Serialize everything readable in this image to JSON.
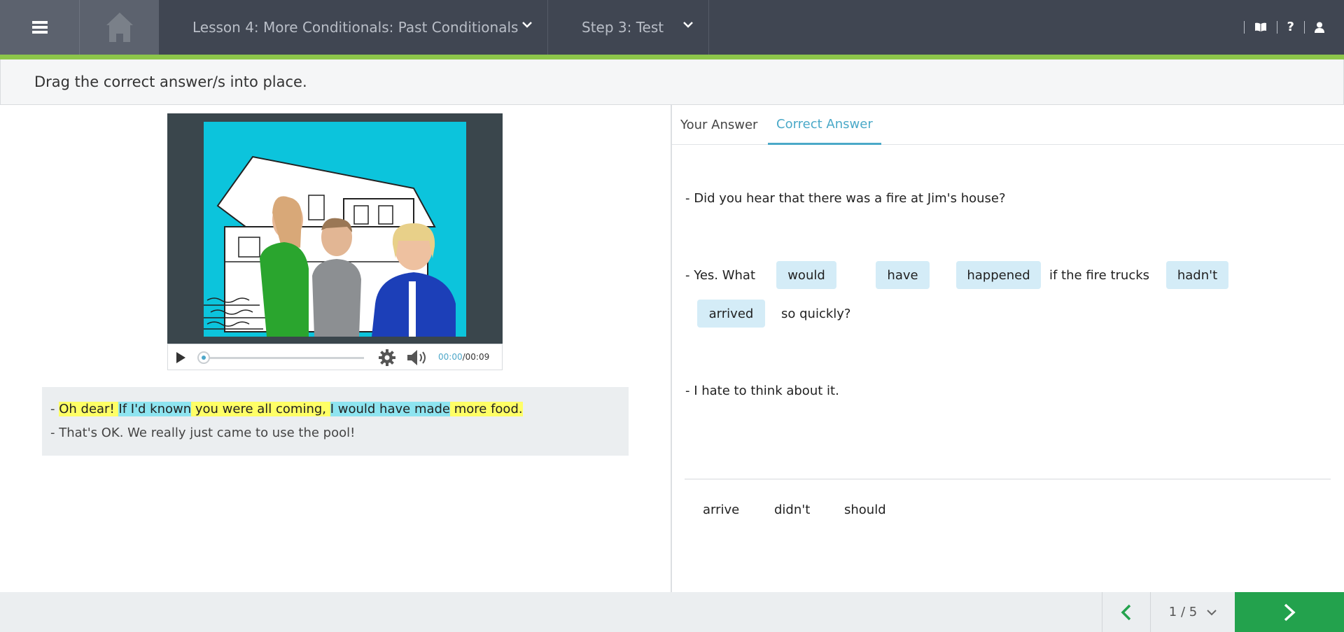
{
  "topbar": {
    "lesson_title": "Lesson 4: More Conditionals: Past Conditionals",
    "step_title": "Step 3: Test",
    "help_label": "?"
  },
  "instruction": "Drag the correct answer/s into place.",
  "video": {
    "current_time": "00:00",
    "separator": "/",
    "duration": "00:09"
  },
  "transcript": {
    "line1": {
      "prefix": "- ",
      "seg1": "Oh dear! ",
      "seg2": "If I'd known",
      "seg3": " you were all coming, ",
      "seg4": "I would have made",
      "seg5": " more food."
    },
    "line2": "- That's OK. We really just came to use the pool!"
  },
  "tabs": {
    "your_answer": "Your Answer",
    "correct_answer": "Correct Answer"
  },
  "exercise": {
    "line1": "- Did you hear that there was a fire at Jim's house?",
    "line2_start": "- Yes. What",
    "chip_would": "would",
    "chip_have": "have",
    "chip_happened": "happened",
    "line2_mid": "if the fire trucks",
    "chip_hadnt": "hadn't",
    "chip_arrived": "arrived",
    "line2_end": "so quickly?",
    "line3": "- I hate to think about it."
  },
  "word_bank": [
    "arrive",
    "didn't",
    "should"
  ],
  "footer": {
    "page_indicator": "1 / 5"
  },
  "colors": {
    "topbar_bg": "#404652",
    "accent_green": "#8dc64a",
    "next_button": "#23a24d",
    "tab_active": "#4aa9c8",
    "chip_bg": "#d4ecf7",
    "highlight_yellow": "#ffff66",
    "highlight_blue": "#8ee4f0"
  }
}
